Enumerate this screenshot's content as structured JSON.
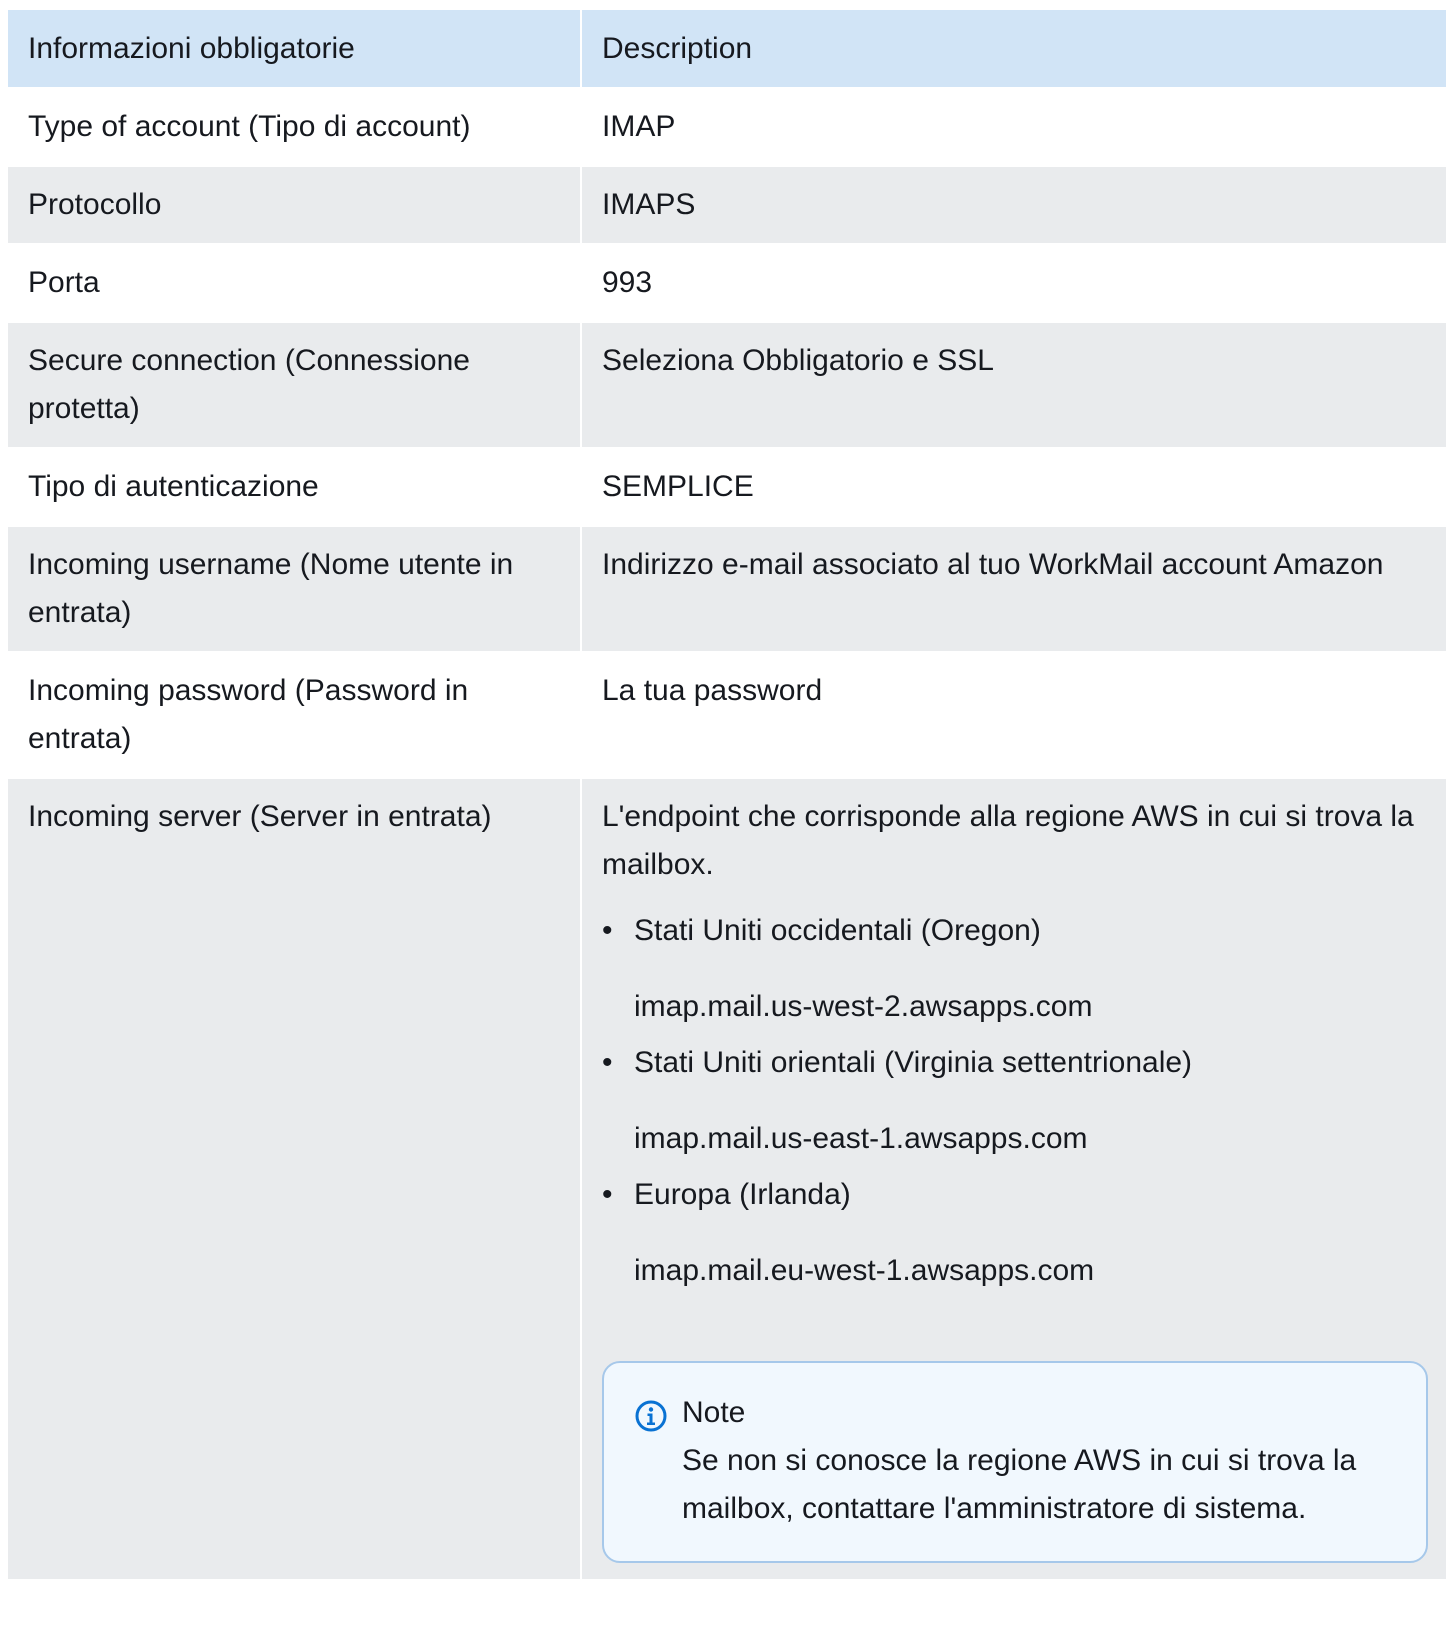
{
  "table": {
    "headers": [
      "Informazioni obbligatorie",
      "Description"
    ],
    "rows": [
      {
        "label": "Type of account (Tipo di account)",
        "value": "IMAP"
      },
      {
        "label": "Protocollo",
        "value": "IMAPS"
      },
      {
        "label": "Porta",
        "value": "993"
      },
      {
        "label": "Secure connection (Connessione protetta)",
        "value": "Seleziona Obbligatorio e SSL"
      },
      {
        "label": "Tipo di autenticazione",
        "value": "SEMPLICE"
      },
      {
        "label": "Incoming username (Nome utente in entrata)",
        "value": "Indirizzo e-mail associato al tuo WorkMail account Amazon"
      },
      {
        "label": "Incoming password (Password in entrata)",
        "value": "La tua password"
      }
    ],
    "server_row": {
      "label": "Incoming server (Server in entrata)",
      "intro": "L'endpoint che corrisponde alla regione AWS in cui si trova la mailbox.",
      "regions": [
        {
          "name": "Stati Uniti occidentali (Oregon)",
          "endpoint": "imap.mail.us-west-2.awsapps.com"
        },
        {
          "name": "Stati Uniti orientali (Virginia settentrionale)",
          "endpoint": "imap.mail.us-east-1.awsapps.com"
        },
        {
          "name": "Europa (Irlanda)",
          "endpoint": "imap.mail.eu-west-1.awsapps.com"
        }
      ],
      "note": {
        "icon": "info-icon",
        "title": "Note",
        "text": "Se non si conosce la regione AWS in cui si trova la mailbox, contattare l'amministratore di sistema."
      }
    }
  },
  "colors": {
    "header_bg": "#d1e4f6",
    "row_alt_bg": "#e9ebed",
    "note_bg": "#f1f8fe",
    "note_border": "#a6c8ea",
    "info_icon": "#0972d3",
    "text": "#16191f"
  }
}
